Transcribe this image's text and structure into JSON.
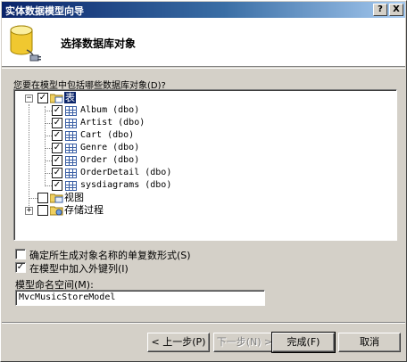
{
  "window": {
    "title": "实体数据模型向导",
    "help_glyph": "?",
    "close_glyph": "X"
  },
  "header": {
    "heading": "选择数据库对象"
  },
  "prompt": "您要在模型中包括哪些数据库对象(D)?",
  "tree": {
    "expanded_glyph": "−",
    "collapsed_glyph": "+",
    "check_glyph": "✓",
    "tables_label": "表",
    "tables": [
      "Album (dbo)",
      "Artist (dbo)",
      "Cart (dbo)",
      "Genre (dbo)",
      "Order (dbo)",
      "OrderDetail (dbo)",
      "sysdiagrams (dbo)"
    ],
    "views_label": "视图",
    "procs_label": "存储过程"
  },
  "options": {
    "pluralize": {
      "label": "确定所生成对象名称的单复数形式(S)",
      "checked": false
    },
    "foreign_keys": {
      "label": "在模型中加入外键列(I)",
      "checked": true
    }
  },
  "namespace": {
    "label": "模型命名空间(M):",
    "value": "MvcMusicStoreModel"
  },
  "buttons": {
    "back": "< 上一步(P)",
    "next": "下一步(N) >",
    "finish": "完成(F)",
    "cancel": "取消"
  },
  "colors": {
    "title_start": "#0a246a",
    "title_end": "#a6caf0",
    "selection": "#0a246a",
    "face": "#d4d0c8"
  }
}
